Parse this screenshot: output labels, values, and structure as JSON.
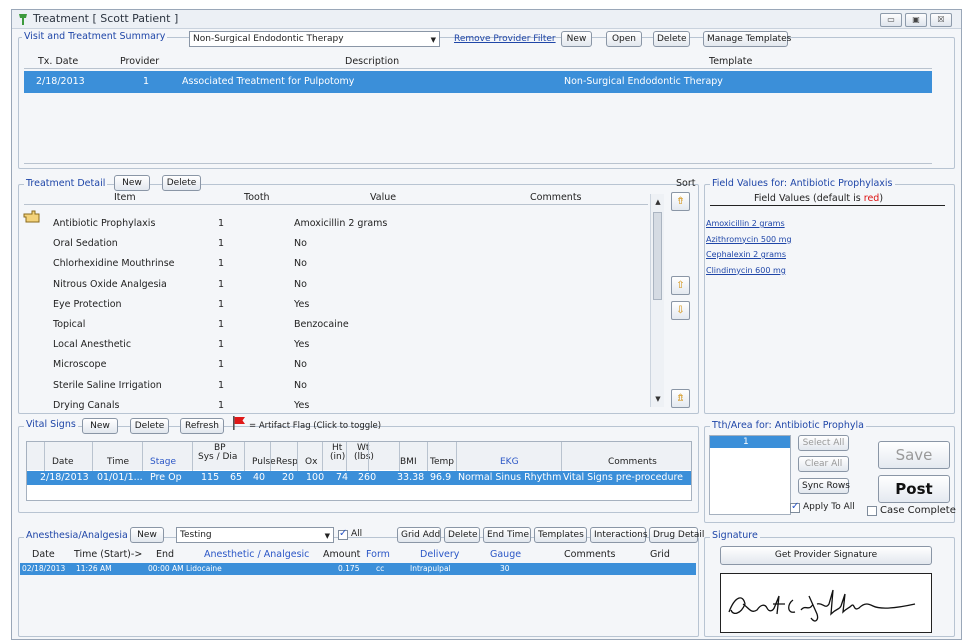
{
  "window": {
    "title": "Treatment [ Scott Patient ]",
    "min": "▭",
    "max": "▣",
    "close": "☒"
  },
  "summary": {
    "label": "Visit and Treatment Summary",
    "template_select": "Non-Surgical Endodontic Therapy",
    "remove_filter": "Remove Provider Filter",
    "buttons": {
      "new": "New",
      "open": "Open",
      "delete": "Delete",
      "manage": "Manage Templates"
    },
    "columns": {
      "date": "Tx. Date",
      "provider": "Provider",
      "description": "Description",
      "template": "Template"
    },
    "row": {
      "date": "2/18/2013",
      "provider": "1",
      "description": "Associated Treatment for Pulpotomy",
      "template": "Non-Surgical Endodontic Therapy"
    }
  },
  "detail": {
    "label": "Treatment Detail",
    "buttons": {
      "new": "New",
      "delete": "Delete"
    },
    "columns": {
      "item": "Item",
      "tooth": "Tooth",
      "value": "Value",
      "comments": "Comments"
    },
    "rows": [
      {
        "item": "Antibiotic Prophylaxis",
        "tooth": "1",
        "value": "Amoxicillin 2 grams"
      },
      {
        "item": "Oral Sedation",
        "tooth": "1",
        "value": "No"
      },
      {
        "item": "Chlorhexidine Mouthrinse",
        "tooth": "1",
        "value": "No"
      },
      {
        "item": "Nitrous Oxide Analgesia",
        "tooth": "1",
        "value": "No"
      },
      {
        "item": "Eye Protection",
        "tooth": "1",
        "value": "Yes"
      },
      {
        "item": "Topical",
        "tooth": "1",
        "value": "Benzocaine"
      },
      {
        "item": "Local Anesthetic",
        "tooth": "1",
        "value": "Yes"
      },
      {
        "item": "Microscope",
        "tooth": "1",
        "value": "No"
      },
      {
        "item": "Sterile Saline Irrigation",
        "tooth": "1",
        "value": "No"
      },
      {
        "item": "Drying Canals",
        "tooth": "1",
        "value": "Yes"
      }
    ],
    "sort_label": "Sort"
  },
  "field_values": {
    "label": "Field Values for: Antibiotic Prophylaxis",
    "header_prefix": "Field Values (default is ",
    "header_red": "red",
    "header_suffix": ")",
    "items": [
      "Amoxicillin 2 grams",
      "Azithromycin 500 mg",
      "Cephalexin 2 grams",
      "Clindimycin 600 mg"
    ]
  },
  "vitals": {
    "label": "Vital Signs",
    "buttons": {
      "new": "New",
      "delete": "Delete",
      "refresh": "Refresh"
    },
    "flag_text": "= Artifact Flag (Click to toggle)",
    "columns": {
      "date": "Date",
      "time": "Time",
      "stage": "Stage",
      "bp_top": "BP",
      "bp_bottom": "Sys / Dia",
      "pulse": "Pulse",
      "resp": "Resp",
      "ox": "Ox",
      "ht_top": "Ht",
      "ht_bottom": "(in)",
      "wt_top": "Wt",
      "wt_bottom": "(lbs)",
      "bmi": "BMI",
      "temp": "Temp",
      "ekg": "EKG",
      "comments": "Comments"
    },
    "row": {
      "date": "2/18/2013",
      "time": "01/01/1...",
      "stage": "Pre Op",
      "sys": "115",
      "dia": "65",
      "pulse": "40",
      "resp": "20",
      "ox": "100",
      "ht": "74",
      "wt": "260",
      "bmi": "33.38",
      "temp": "96.9",
      "ekg": "Normal Sinus Rhythm",
      "comments": "Vital Signs pre-procedure"
    }
  },
  "tooth_area": {
    "label": "Tth/Area for: Antibiotic Prophyla",
    "value": "1",
    "select_all": "Select All",
    "clear_all": "Clear All",
    "sync_rows": "Sync Rows",
    "apply_all": "Apply To All"
  },
  "actions": {
    "save": "Save",
    "post": "Post",
    "case_complete": "Case Complete"
  },
  "anesthesia": {
    "label": "Anesthesia/Analgesia",
    "new": "New",
    "select": "Testing",
    "all": "All",
    "buttons": {
      "grid_add": "Grid Add",
      "delete": "Delete",
      "end_time": "End Time",
      "templates": "Templates",
      "interactions": "Interactions",
      "drug_detail": "Drug Detail"
    },
    "columns": {
      "date": "Date",
      "time": "Time (Start)->",
      "end": "End",
      "anesthetic": "Anesthetic / Analgesic",
      "amount": "Amount",
      "form": "Form",
      "delivery": "Delivery",
      "gauge": "Gauge",
      "comments": "Comments",
      "grid": "Grid"
    },
    "row": {
      "date": "02/18/2013",
      "time": "11:26 AM",
      "end": "00:00 AM",
      "anesthetic": "Lidocaine",
      "amount": "0.175",
      "form": "cc",
      "delivery": "Intrapulpal",
      "gauge": "30"
    }
  },
  "signature": {
    "label": "Signature",
    "button": "Get Provider Signature"
  },
  "colors": {
    "selection": "#3b8fd9",
    "link": "#1f46a8",
    "section_label": "#1f46a8"
  }
}
